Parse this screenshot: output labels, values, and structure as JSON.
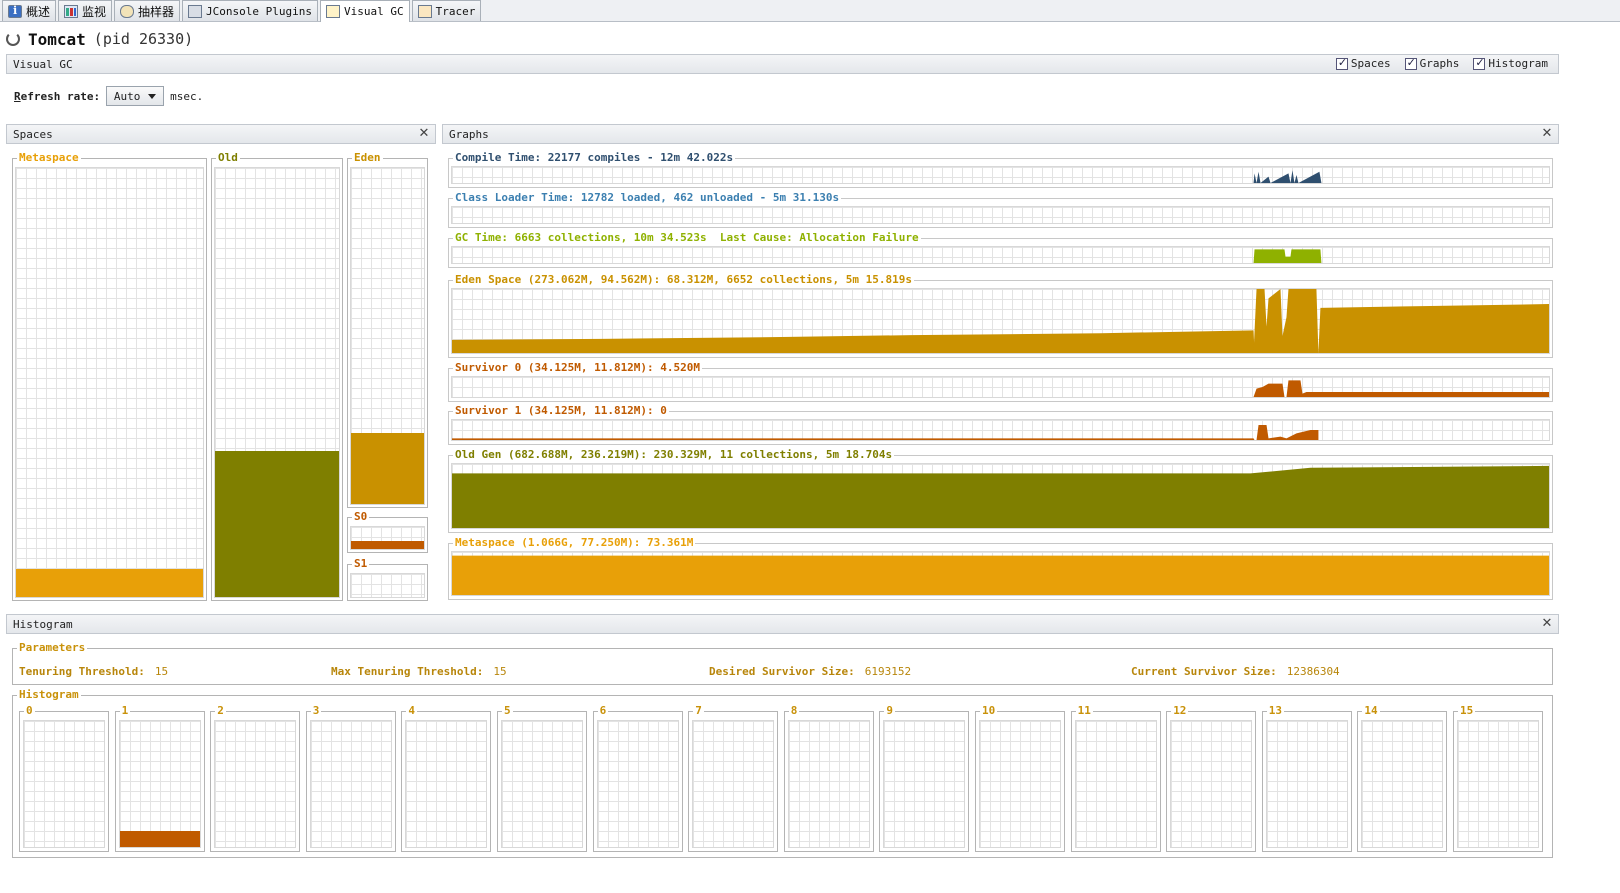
{
  "tabs": [
    {
      "label": "概述",
      "icon": "info-icon",
      "active": false
    },
    {
      "label": "监视",
      "icon": "monitor-chart-icon",
      "active": false
    },
    {
      "label": "抽样器",
      "icon": "sampler-icon",
      "active": false
    },
    {
      "label": "JConsole Plugins",
      "icon": "plugin-icon",
      "active": false
    },
    {
      "label": "Visual GC",
      "icon": "visual-gc-icon",
      "active": true
    },
    {
      "label": "Tracer",
      "icon": "tracer-icon",
      "active": false
    }
  ],
  "title": {
    "app": "Tomcat",
    "pid": "(pid 26330)"
  },
  "visual_gc": {
    "header": "Visual GC",
    "checkboxes": [
      {
        "label": "Spaces",
        "checked": true
      },
      {
        "label": "Graphs",
        "checked": true
      },
      {
        "label": "Histogram",
        "checked": true
      }
    ],
    "refresh_label_prefix": "R",
    "refresh_label_rest": "efresh rate:",
    "refresh_value": "Auto",
    "refresh_unit": "msec."
  },
  "spaces": {
    "header": "Spaces",
    "close": "✕",
    "metaspace": {
      "label": "Metaspace",
      "fill": 0.065,
      "color": "#e8a008"
    },
    "old": {
      "label": "Old",
      "fill": 0.34,
      "color": "#7f7f00"
    },
    "eden": {
      "label": "Eden",
      "fill": 0.21,
      "color": "#c99100"
    },
    "s0": {
      "label": "S0",
      "fill": 0.35,
      "color": "#c05a00"
    },
    "s1": {
      "label": "S1",
      "fill": 0.0,
      "color": "#c05a00"
    }
  },
  "graphs": {
    "header": "Graphs",
    "close": "✕",
    "rows": [
      {
        "label": "Compile Time: 22177 compiles - 12m 42.022s",
        "color": "#2f4f6f"
      },
      {
        "label": "Class Loader Time: 12782 loaded, 462 unloaded - 5m 31.130s",
        "color": "#3b7fb0"
      },
      {
        "label": "GC Time: 6663 collections, 10m 34.523s  Last Cause: Allocation Failure",
        "color": "#8fb100"
      },
      {
        "label": "Eden Space (273.062M, 94.562M): 68.312M, 6652 collections, 5m 15.819s",
        "color": "#c99100"
      },
      {
        "label": "Survivor 0 (34.125M, 11.812M): 4.520M",
        "color": "#c05a00"
      },
      {
        "label": "Survivor 1 (34.125M, 11.812M): 0",
        "color": "#c05a00"
      },
      {
        "label": "Old Gen (682.688M, 236.219M): 230.329M, 11 collections, 5m 18.704s",
        "color": "#7f7f00"
      },
      {
        "label": "Metaspace (1.066G, 77.250M): 73.361M",
        "color": "#e8a008"
      }
    ]
  },
  "histogram": {
    "header": "Histogram",
    "close": "✕",
    "parameters_label": "Parameters",
    "params": [
      {
        "key": "Tenuring Threshold:",
        "value": "15"
      },
      {
        "key": "Max Tenuring Threshold:",
        "value": "15"
      },
      {
        "key": "Desired Survivor Size:",
        "value": "6193152"
      },
      {
        "key": "Current Survivor Size:",
        "value": "12386304"
      }
    ],
    "histogram_label": "Histogram",
    "bins": [
      {
        "label": "0",
        "fill": 0.0
      },
      {
        "label": "1",
        "fill": 0.13
      },
      {
        "label": "2",
        "fill": 0.0
      },
      {
        "label": "3",
        "fill": 0.0
      },
      {
        "label": "4",
        "fill": 0.0
      },
      {
        "label": "5",
        "fill": 0.0
      },
      {
        "label": "6",
        "fill": 0.0
      },
      {
        "label": "7",
        "fill": 0.0
      },
      {
        "label": "8",
        "fill": 0.0
      },
      {
        "label": "9",
        "fill": 0.0
      },
      {
        "label": "10",
        "fill": 0.0
      },
      {
        "label": "11",
        "fill": 0.0
      },
      {
        "label": "12",
        "fill": 0.0
      },
      {
        "label": "13",
        "fill": 0.0
      },
      {
        "label": "14",
        "fill": 0.0
      },
      {
        "label": "15",
        "fill": 0.0
      }
    ],
    "bin_color": "#c05a00"
  }
}
